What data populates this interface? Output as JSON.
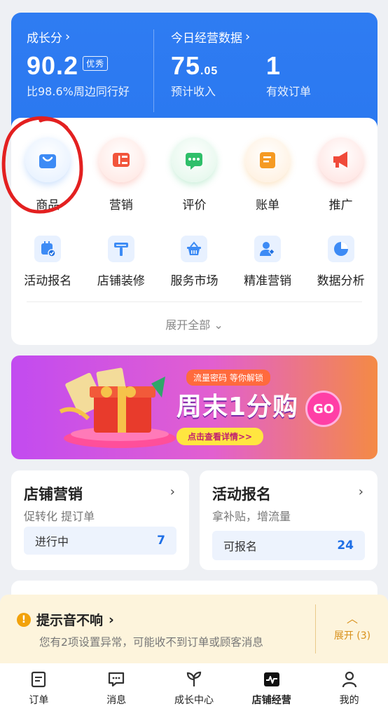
{
  "header": {
    "growth_title": "成长分",
    "growth_score": "90.2",
    "growth_badge": "优秀",
    "growth_compare": "比98.6%周边同行好",
    "today_title": "今日经营数据",
    "income_int": "75",
    "income_dec": ".05",
    "income_label": "预计收入",
    "orders_value": "1",
    "orders_label": "有效订单"
  },
  "quick_icons": [
    {
      "label": "商品",
      "icon": "shopping-bag-icon",
      "color": "#3d8bf5"
    },
    {
      "label": "营销",
      "icon": "ticket-icon",
      "color": "#f2553c"
    },
    {
      "label": "评价",
      "icon": "chat-bubble-icon",
      "color": "#2fbf6a"
    },
    {
      "label": "账单",
      "icon": "wallet-icon",
      "color": "#f59a23"
    },
    {
      "label": "推广",
      "icon": "megaphone-icon",
      "color": "#f04a3a"
    }
  ],
  "tools": [
    {
      "label": "活动报名",
      "icon": "calendar-check-icon"
    },
    {
      "label": "店铺装修",
      "icon": "paint-roller-icon"
    },
    {
      "label": "服务市场",
      "icon": "basket-icon"
    },
    {
      "label": "精准营销",
      "icon": "target-user-icon"
    },
    {
      "label": "数据分析",
      "icon": "pie-chart-icon"
    }
  ],
  "expand_all": "展开全部",
  "banner": {
    "tag": "流量密码 等你解锁",
    "title": "周末1分购",
    "go": "GO",
    "cta": "点击查看详情>>"
  },
  "store_marketing": {
    "title": "店铺营销",
    "subtitle": "促转化 提订单",
    "status_label": "进行中",
    "status_count": "7"
  },
  "activity_signup": {
    "title": "活动报名",
    "subtitle": "拿补贴，增流量",
    "status_label": "可报名",
    "status_count": "24"
  },
  "notice": {
    "title": "提示音不响",
    "description": "您有2项设置异常，可能收不到订单或顾客消息",
    "expand": "展开 (3)"
  },
  "bottom_nav": [
    {
      "label": "订单",
      "icon": "order-icon"
    },
    {
      "label": "消息",
      "icon": "message-icon"
    },
    {
      "label": "成长中心",
      "icon": "sprout-icon"
    },
    {
      "label": "店铺经营",
      "icon": "pulse-icon"
    },
    {
      "label": "我的",
      "icon": "user-icon"
    }
  ],
  "colors": {
    "primary_blue": "#2a78f0",
    "warning_orange": "#f2a20b",
    "annotation_red": "#e32020"
  }
}
